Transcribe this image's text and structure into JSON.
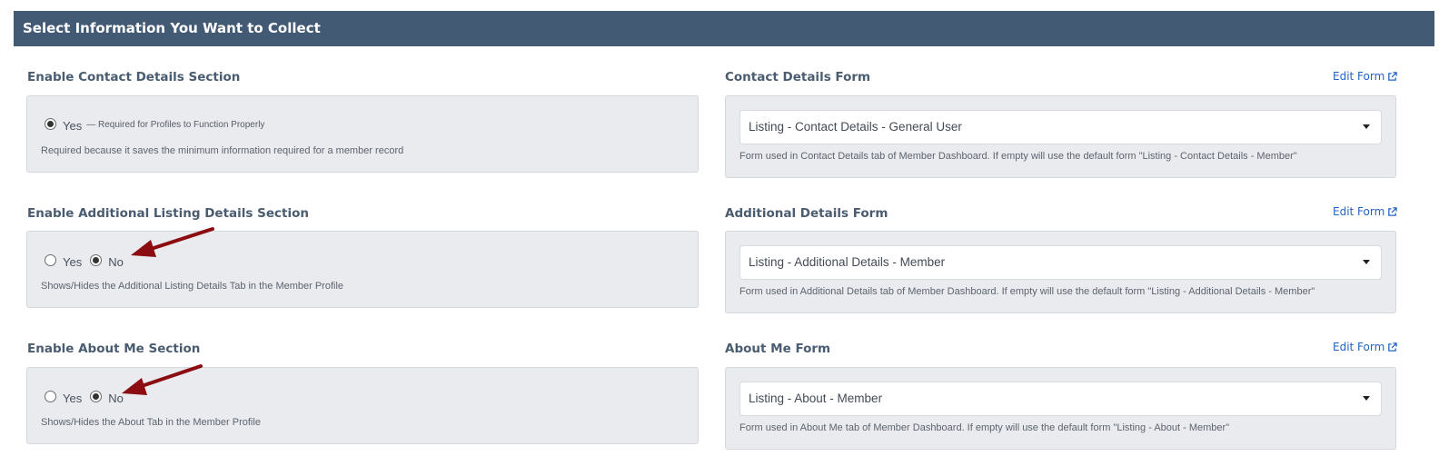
{
  "header": {
    "title": "Select Information You Want to Collect"
  },
  "sections": [
    {
      "label": "Enable Contact Details Section",
      "options": [
        {
          "label": "Yes",
          "checked": true
        }
      ],
      "note": "— Required for Profiles to Function Properly",
      "description": "Required because it saves the minimum information required for a member record"
    },
    {
      "label": "Enable Additional Listing Details Section",
      "options": [
        {
          "label": "Yes",
          "checked": false
        },
        {
          "label": "No",
          "checked": true
        }
      ],
      "description": "Shows/Hides the Additional Listing Details Tab in the Member Profile"
    },
    {
      "label": "Enable About Me Section",
      "options": [
        {
          "label": "Yes",
          "checked": false
        },
        {
          "label": "No",
          "checked": true
        }
      ],
      "description": "Shows/Hides the About Tab in the Member Profile"
    }
  ],
  "forms": [
    {
      "label": "Contact Details Form",
      "edit_label": "Edit Form",
      "selected": "Listing - Contact Details - General User",
      "help": "Form used in Contact Details tab of Member Dashboard. If empty will use the default form \"Listing - Contact Details - Member\""
    },
    {
      "label": "Additional Details Form",
      "edit_label": "Edit Form",
      "selected": "Listing - Additional Details - Member",
      "help": "Form used in Additional Details tab of Member Dashboard. If empty will use the default form \"Listing - Additional Details - Member\""
    },
    {
      "label": "About Me Form",
      "edit_label": "Edit Form",
      "selected": "Listing - About - Member",
      "help": "Form used in About Me tab of Member Dashboard. If empty will use the default form \"Listing - About - Member\""
    }
  ],
  "colors": {
    "header_bg": "#425a74",
    "panel_bg": "#e9ebee",
    "link": "#2363c4",
    "annotation_arrow": "#8b0d12"
  },
  "icons": {
    "edit_link": "external-link-icon",
    "select": "caret-down-icon"
  }
}
